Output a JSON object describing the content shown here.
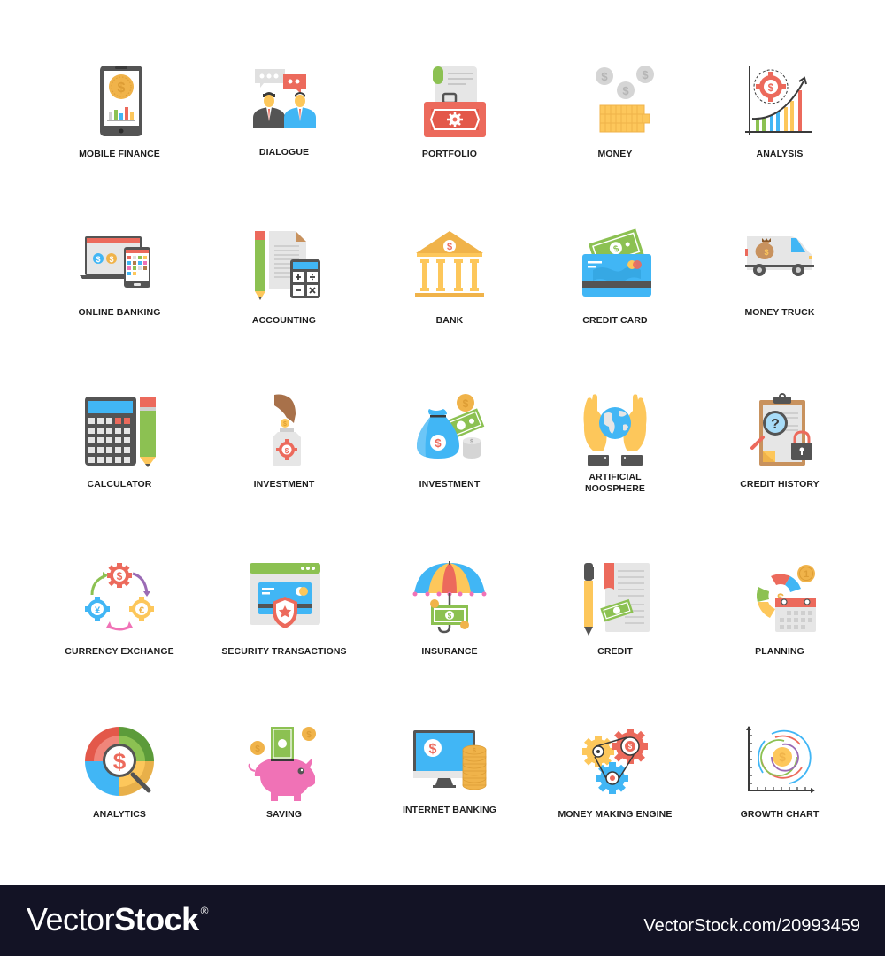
{
  "icons": [
    {
      "label": "MOBILE FINANCE",
      "icon": "mobile-finance-icon"
    },
    {
      "label": "DIALOGUE",
      "icon": "dialogue-icon"
    },
    {
      "label": "PORTFOLIO",
      "icon": "portfolio-icon"
    },
    {
      "label": "MONEY",
      "icon": "money-icon"
    },
    {
      "label": "ANALYSIS",
      "icon": "analysis-icon"
    },
    {
      "label": "ONLINE BANKING",
      "icon": "online-banking-icon"
    },
    {
      "label": "ACCOUNTING",
      "icon": "accounting-icon"
    },
    {
      "label": "BANK",
      "icon": "bank-icon"
    },
    {
      "label": "CREDIT CARD",
      "icon": "credit-card-icon"
    },
    {
      "label": "MONEY TRUCK",
      "icon": "money-truck-icon"
    },
    {
      "label": "CALCULATOR",
      "icon": "calculator-icon"
    },
    {
      "label": "INVESTMENT",
      "icon": "investment-jar-icon"
    },
    {
      "label": "INVESTMENT",
      "icon": "investment-bag-icon"
    },
    {
      "label": "ARTIFICIAL",
      "label2": "NOOSPHERE",
      "icon": "globe-hands-icon"
    },
    {
      "label": "CREDIT HISTORY",
      "icon": "credit-history-icon"
    },
    {
      "label": "CURRENCY EXCHANGE",
      "icon": "currency-exchange-icon"
    },
    {
      "label": "SECURITY TRANSACTIONS",
      "icon": "security-transactions-icon"
    },
    {
      "label": "INSURANCE",
      "icon": "insurance-icon"
    },
    {
      "label": "CREDIT",
      "icon": "credit-icon"
    },
    {
      "label": "PLANNING",
      "icon": "planning-icon"
    },
    {
      "label": "ANALYTICS",
      "icon": "analytics-icon"
    },
    {
      "label": "SAVING",
      "icon": "saving-icon"
    },
    {
      "label": "INTERNET BANKING",
      "icon": "internet-banking-icon"
    },
    {
      "label": "MONEY MAKING ENGINE",
      "icon": "money-making-engine-icon"
    },
    {
      "label": "GROWTH CHART",
      "icon": "growth-chart-icon"
    }
  ],
  "glyphs": {
    "dollar": "$",
    "yen": "¥",
    "euro": "€",
    "question": "?",
    "one": "1"
  },
  "colors": {
    "red": "#ec6a5c",
    "yellow": "#fdc75b",
    "gold": "#f0b34a",
    "blue": "#41b6f5",
    "green": "#8cc152",
    "dark": "#545454",
    "gray": "#e6e6e6",
    "footer": "#131325"
  },
  "footer": {
    "brand_light": "Vector",
    "brand_bold": "Stock",
    "registered": "®",
    "reference": "VectorStock.com/20993459"
  }
}
